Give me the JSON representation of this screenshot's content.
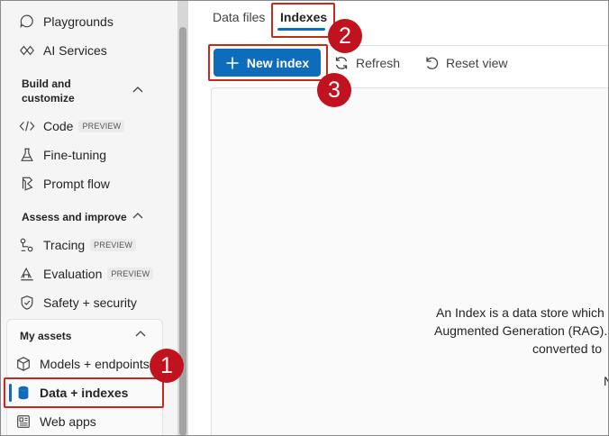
{
  "sidebar": {
    "items": [
      {
        "label": "Playgrounds",
        "icon": "playground-icon"
      },
      {
        "label": "AI Services",
        "icon": "ai-services-icon"
      }
    ],
    "build_section": {
      "title_line1": "Build and",
      "title_line2": "customize",
      "items": [
        {
          "label": "Code",
          "badge": "PREVIEW",
          "icon": "code-icon"
        },
        {
          "label": "Fine-tuning",
          "icon": "flask-icon"
        },
        {
          "label": "Prompt flow",
          "icon": "prompt-flow-icon"
        }
      ]
    },
    "assess_section": {
      "title": "Assess and improve",
      "items": [
        {
          "label": "Tracing",
          "badge": "PREVIEW",
          "icon": "tracing-icon"
        },
        {
          "label": "Evaluation",
          "badge": "PREVIEW",
          "icon": "evaluation-icon"
        },
        {
          "label": "Safety + security",
          "icon": "shield-icon"
        }
      ]
    },
    "assets_section": {
      "title": "My assets",
      "items": [
        {
          "label": "Models + endpoints",
          "icon": "cube-icon"
        },
        {
          "label": "Data + indexes",
          "icon": "database-icon",
          "selected": true
        },
        {
          "label": "Web apps",
          "icon": "web-app-icon"
        }
      ]
    }
  },
  "tabs": [
    {
      "label": "Data files",
      "active": false
    },
    {
      "label": "Indexes",
      "active": true
    }
  ],
  "toolbar": {
    "new_index_label": "New index",
    "refresh_label": "Refresh",
    "reset_view_label": "Reset view"
  },
  "description": {
    "line1": "An Index is a data store which a",
    "line2": "Augmented Generation (RAG). A",
    "line3": "converted to",
    "line4": "N"
  },
  "markers": [
    "1",
    "2",
    "3"
  ],
  "colors": {
    "accent": "#0f6cbd",
    "marker": "#c1121f",
    "highlight_border": "#c42b1c"
  }
}
